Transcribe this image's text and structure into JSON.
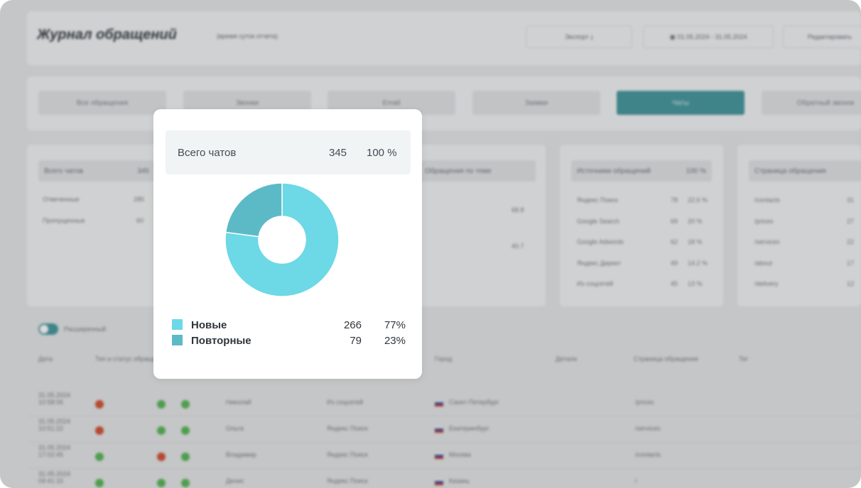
{
  "background": {
    "page_title": "Журнал обращений",
    "subtitle": "(время суток отчета)",
    "export_label": "Экспорт",
    "date_range": "01.05.2024 - 31.05.2024",
    "edit_label": "Редактировать",
    "tabs": [
      "Все обращения",
      "Звонки",
      "Email",
      "Заявки",
      "Чаты",
      "Обратный звонок"
    ],
    "panels": {
      "p1_head": "Всего чатов",
      "p1_head_val": "345",
      "p1_rows": [
        [
          "Отвеченные",
          "285"
        ],
        [
          "Пропущенные",
          "60"
        ]
      ],
      "p2_head": "Обращения по теме",
      "p3_head": "Источники обращений",
      "p3_head_val": "100 %",
      "p3_rows": [
        [
          "Яндекс Поиск",
          "78",
          "22.6 %"
        ],
        [
          "Google Search",
          "69",
          "20 %"
        ],
        [
          "Google Adwords",
          "62",
          "18 %"
        ],
        [
          "Яндекс Директ",
          "49",
          "14.2 %"
        ],
        [
          "Из соцсетей",
          "45",
          "13 %"
        ]
      ],
      "p4_head": "Страница обращения",
      "p4_rows": [
        [
          "/contacts",
          "31"
        ],
        [
          "/prices",
          "27"
        ],
        [
          "/services",
          "22"
        ],
        [
          "/about",
          "17"
        ],
        [
          "/delivery",
          "12"
        ]
      ]
    },
    "toggle_label": "Расширенный",
    "columns": [
      "Дата",
      "Тип и статус обращения",
      "Город",
      "Детали",
      "Страница обращения",
      "Тег"
    ],
    "rows": [
      {
        "date": "31.05.2024 10:58:06",
        "name": "Николай",
        "source": "Из соцсетей",
        "city": "Санкт-Петербург",
        "page": "/prices"
      },
      {
        "date": "31.05.2024 10:51:22",
        "name": "Ольга",
        "source": "Яндекс Поиск",
        "city": "Екатеринбург",
        "page": "/services"
      },
      {
        "date": "31.05.2024 17:02:45",
        "name": "Владимир",
        "source": "Яндекс Поиск",
        "city": "Москва",
        "page": "/contacts"
      },
      {
        "date": "31.05.2024 09:41:15",
        "name": "Денис",
        "source": "Яндекс Поиск",
        "city": "Казань",
        "page": "/"
      }
    ]
  },
  "popup": {
    "summary_label": "Всего чатов",
    "summary_count": "345",
    "summary_percent": "100 %",
    "items": [
      {
        "name": "Новые",
        "count": "266",
        "percent": "77%",
        "color": "#6dd8e6"
      },
      {
        "name": "Повторные",
        "count": "79",
        "percent": "23%",
        "color": "#5cbac7"
      }
    ]
  },
  "chart_data": {
    "type": "pie",
    "categories": [
      "Новые",
      "Повторные"
    ],
    "values": [
      266,
      79
    ],
    "colors": [
      "#6dd8e6",
      "#5cbac7"
    ],
    "donut": true
  }
}
